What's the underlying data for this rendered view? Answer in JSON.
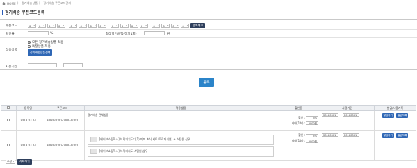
{
  "breadcrumb": {
    "home": "HOME",
    "level1": "정기배송상품",
    "level2": "정기배송 쿠폰코드관리"
  },
  "page_title": "정기배송 쿠폰코드등록",
  "form": {
    "coupon_code_label": "쿠폰코드",
    "coupon_code_values": [
      "0",
      "0",
      "0",
      "0",
      "0",
      "0",
      "0",
      "0",
      "0",
      "0",
      "0",
      "0",
      "0",
      "0",
      "0",
      "0"
    ],
    "check_button": "중복체크",
    "discount_rate_label": "할인율",
    "discount_rate_unit": "%",
    "max_discount_label": "최대할인금액(정기1회)",
    "max_discount_unit": "원",
    "apply_product_label": "적용상품",
    "radio_all": "모든 정기배송상품 적용",
    "radio_specific": "특정상품 적용",
    "select_product_button": "정기배송상품선택",
    "period_label": "사용기간",
    "period_sep": "~"
  },
  "register_button": "등록",
  "table": {
    "headers": [
      "",
      "등록일",
      "쿠폰코드",
      "적용상품",
      "할인율",
      "사용기간",
      "발급/사용기록"
    ],
    "rows": [
      {
        "date": "2018.03.24",
        "code": "A000-0000-0000-0000",
        "product": "정기배송 전체상품",
        "discount_label": "할인 :",
        "discount_value": "3%",
        "max_label": "최대(1회) :",
        "max_value": "3000원",
        "start": "20180301",
        "end": "20180331",
        "issue_btn": "발급하기",
        "history_btn": "발급목록"
      },
      {
        "date": "2018.03.24",
        "code": "B000-0000-0000-0000",
        "products": [
          "[데이브쇼핑핵소] 브릭피치도디(1) 매미 초식 세트(토로퍼셔널) + 스팀원 삼우",
          "[데이브쇼핑핵소] 브릭피치도 스팀원 삼우"
        ],
        "discount_label": "할인 :",
        "discount_value": "5%",
        "max_label": "최대(1회) :",
        "max_value": "3000원",
        "start": "20180301",
        "end": "20180331",
        "issue_btn": "발급하기",
        "history_btn": "발급목록"
      }
    ]
  },
  "footer": {
    "edit_select": "수정",
    "delete_button": "삭제하기"
  }
}
